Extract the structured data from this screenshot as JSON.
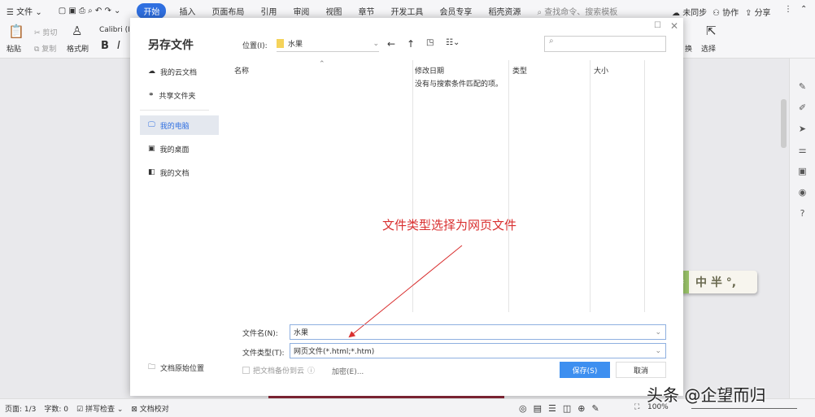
{
  "topbar": {
    "menu": "文件",
    "tabs": [
      "开始",
      "插入",
      "页面布局",
      "引用",
      "审阅",
      "视图",
      "章节",
      "开发工具",
      "会员专享",
      "稻壳资源"
    ],
    "search_placeholder": "查找命令、搜索模板",
    "sync": "未同步",
    "collab": "协作",
    "share": "分享"
  },
  "ribbon": {
    "paste": "粘贴",
    "cut": "剪切",
    "copy": "复制",
    "format_painter": "格式刷",
    "font": "Calibri (I",
    "bold": "B",
    "italic": "I",
    "select": "选择",
    "replace_tail": "换"
  },
  "dialog": {
    "title": "另存文件",
    "location_label": "位置(I):",
    "location_value": "水果",
    "sidebar": [
      {
        "label": "我的云文档",
        "icon": "cloud-icon"
      },
      {
        "label": "共享文件夹",
        "icon": "share-folder-icon"
      },
      {
        "label": "我的电脑",
        "icon": "computer-icon",
        "selected": true
      },
      {
        "label": "我的桌面",
        "icon": "desktop-icon"
      },
      {
        "label": "我的文档",
        "icon": "document-icon"
      }
    ],
    "original_location": "文档原始位置",
    "columns": [
      "名称",
      "修改日期",
      "类型",
      "大小"
    ],
    "empty_message": "没有与搜索条件匹配的项。",
    "filename_label": "文件名(N):",
    "filename_value": "水果",
    "filetype_label": "文件类型(T):",
    "filetype_value": "网页文件(*.html;*.htm)",
    "backup_label": "把文档备份到云",
    "encrypt": "加密(E)...",
    "save": "保存(S)",
    "cancel": "取消"
  },
  "annotation": {
    "text": "文件类型选择为网页文件",
    "color": "#d93030"
  },
  "ime": {
    "text": "中 半 °,"
  },
  "watermark": "头条 @企望而归",
  "status": {
    "page": "页面: 1/3",
    "words": "字数: 0",
    "spell": "拼写检查",
    "proof": "文档校对",
    "zoom": "100%"
  },
  "colors": {
    "accent": "#2f6fe0",
    "save_button": "#3d8ff0"
  }
}
